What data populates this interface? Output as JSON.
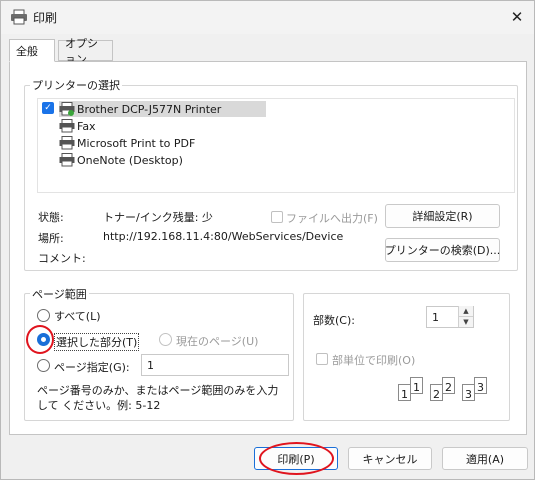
{
  "window": {
    "title": "印刷",
    "close_glyph": "✕",
    "title_icon": "printer-icon"
  },
  "tabs": [
    {
      "label": "全般",
      "active": true
    },
    {
      "label": "オプション",
      "active": false
    }
  ],
  "printer_select": {
    "legend": "プリンターの選択",
    "printers": [
      {
        "name": "Brother DCP-J577N Printer",
        "selected": true,
        "default": true
      },
      {
        "name": "Fax",
        "selected": false
      },
      {
        "name": "Microsoft Print to PDF",
        "selected": false
      },
      {
        "name": "OneNote (Desktop)",
        "selected": false
      }
    ],
    "status_label": "状態:",
    "status_value": "トナー/インク残量: 少",
    "location_label": "場所:",
    "location_value": "http://192.168.11.4:80/WebServices/Device",
    "comment_label": "コメント:",
    "print_to_file_label": "ファイルへ出力(F)",
    "preferences_button": "詳細設定(R)",
    "find_printer_button": "プリンターの検索(D)..."
  },
  "page_range": {
    "legend": "ページ範囲",
    "all_label": "すべて(L)",
    "selection_label": "選択した部分(T)",
    "current_page_label": "現在のページ(U)",
    "pages_label": "ページ指定(G):",
    "pages_value": "1",
    "hint": "ページ番号のみか、またはページ範囲のみを入力して ください。例: 5-12",
    "selected": "selection"
  },
  "copies": {
    "label": "部数(C):",
    "value": "1",
    "collate_label": "部単位で印刷(O)",
    "collate_pages": [
      "1",
      "1",
      "2",
      "2",
      "3",
      "3"
    ]
  },
  "footer": {
    "print_button": "印刷(P)",
    "cancel_button": "キャンセル",
    "apply_button": "適用(A)"
  },
  "colors": {
    "accent": "#1a6fd8",
    "annotation": "#e0141e"
  }
}
